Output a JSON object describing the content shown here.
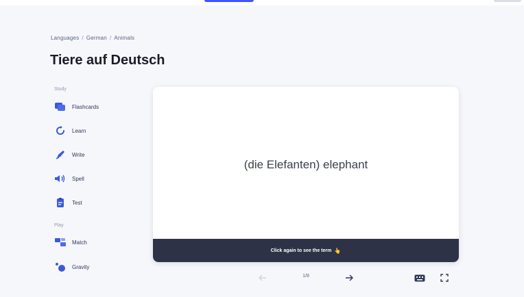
{
  "breadcrumb": {
    "items": [
      "Languages",
      "German",
      "Animals"
    ],
    "separator": "/"
  },
  "page": {
    "title": "Tiere auf Deutsch"
  },
  "sidebar": {
    "study_label": "Study",
    "play_label": "Play",
    "study_items": [
      {
        "label": "Flashcards",
        "icon": "flashcards-icon"
      },
      {
        "label": "Learn",
        "icon": "learn-icon"
      },
      {
        "label": "Write",
        "icon": "write-icon"
      },
      {
        "label": "Spell",
        "icon": "spell-icon"
      },
      {
        "label": "Test",
        "icon": "test-icon"
      }
    ],
    "play_items": [
      {
        "label": "Match",
        "icon": "match-icon"
      },
      {
        "label": "Gravity",
        "icon": "gravity-icon"
      }
    ]
  },
  "card": {
    "term": "(die Elefanten) elephant",
    "hint": "Click again to see the term",
    "hint_emoji": "👆"
  },
  "controls": {
    "counter": "1/8"
  },
  "colors": {
    "accent": "#4255ff",
    "card_footer": "#2e3247",
    "icon_blue": "#3a5bd9",
    "background": "#f6f7fb"
  }
}
